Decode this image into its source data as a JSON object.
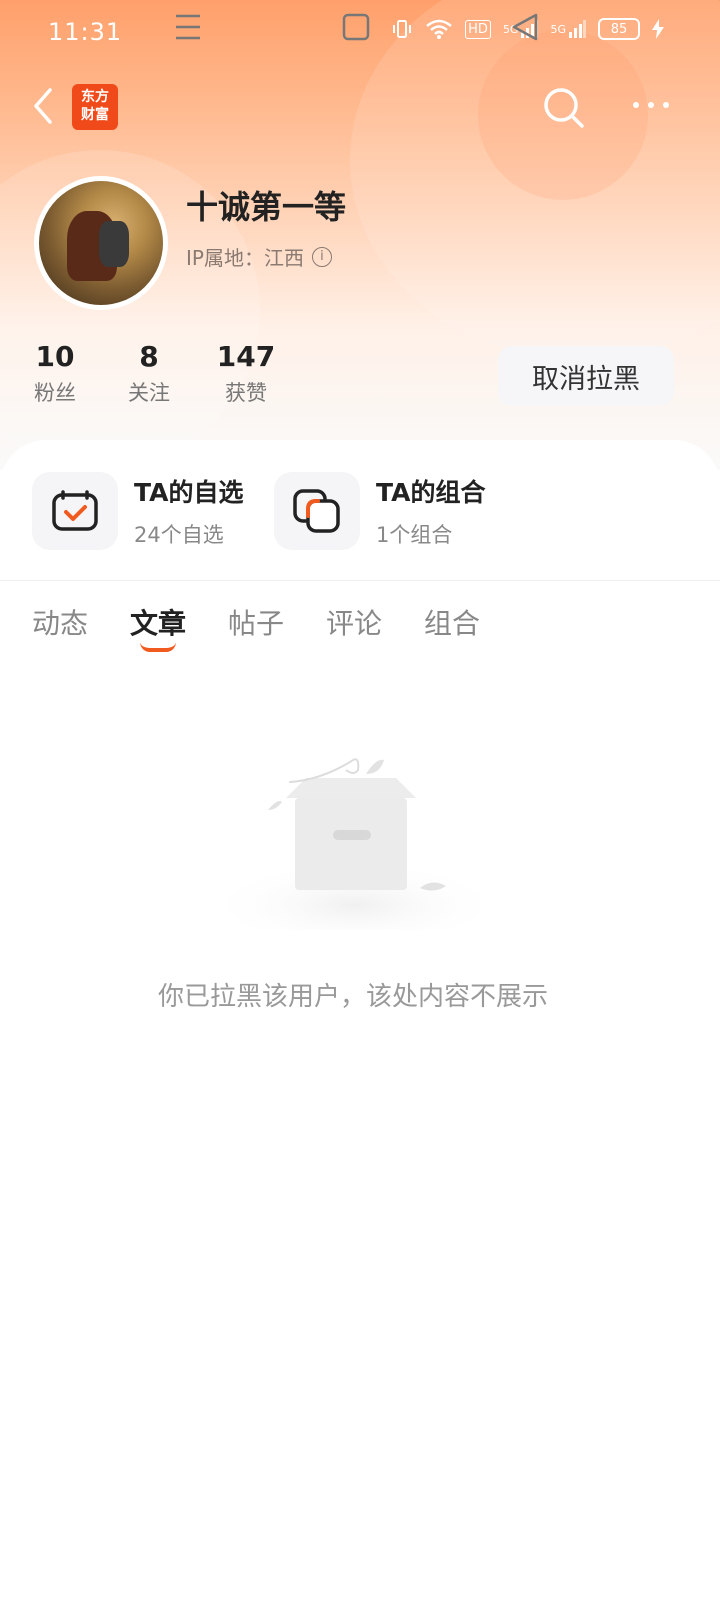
{
  "status_bar": {
    "time": "11:31",
    "battery": "85",
    "signal_labels": [
      "HD",
      "5G",
      "5G"
    ]
  },
  "header": {
    "app_logo_line1": "东方",
    "app_logo_line2": "财富",
    "brand_color": "#f04a1a"
  },
  "profile": {
    "username": "十诚第一等",
    "ip_label": "IP属地：江西",
    "stats": [
      {
        "value": "10",
        "label": "粉丝"
      },
      {
        "value": "8",
        "label": "关注"
      },
      {
        "value": "147",
        "label": "获赞"
      }
    ],
    "unblock_label": "取消拉黑"
  },
  "entries": [
    {
      "title": "TA的自选",
      "sub": "24个自选"
    },
    {
      "title": "TA的组合",
      "sub": "1个组合"
    }
  ],
  "tabs": [
    {
      "label": "动态",
      "active": false
    },
    {
      "label": "文章",
      "active": true
    },
    {
      "label": "帖子",
      "active": false
    },
    {
      "label": "评论",
      "active": false
    },
    {
      "label": "组合",
      "active": false
    }
  ],
  "empty_state": {
    "message": "你已拉黑该用户，该处内容不展示"
  },
  "accent_color": "#f05a1e"
}
